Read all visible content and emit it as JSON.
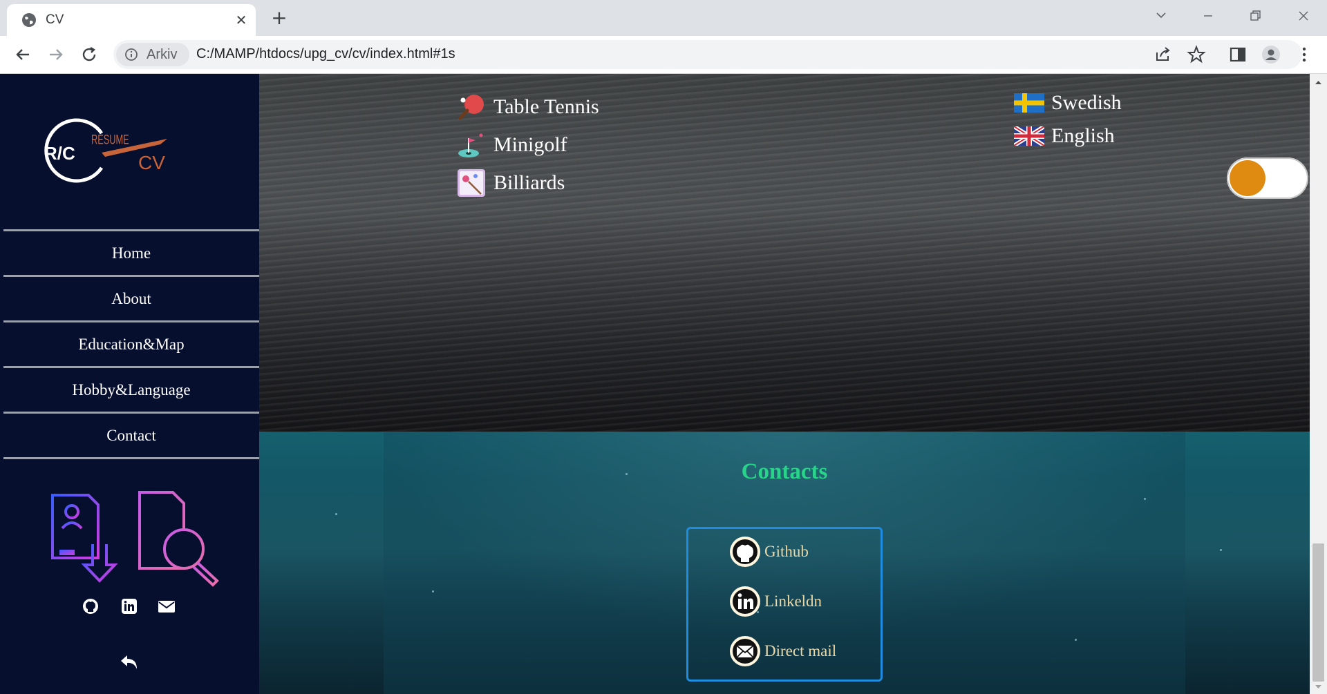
{
  "browser": {
    "tab_title": "CV",
    "chip_label": "Arkiv",
    "url": "C:/MAMP/htdocs/upg_cv/cv/index.html#1s"
  },
  "sidebar": {
    "nav_items": [
      {
        "label": "Home"
      },
      {
        "label": "About"
      },
      {
        "label": "Education&Map"
      },
      {
        "label": "Hobby&Language"
      },
      {
        "label": "Contact"
      }
    ],
    "logo_text": "R/C RESUME CV"
  },
  "hobbies": [
    {
      "label": "Table Tennis",
      "icon": "table-tennis-icon"
    },
    {
      "label": "Minigolf",
      "icon": "minigolf-icon"
    },
    {
      "label": "Billiards",
      "icon": "billiards-icon"
    }
  ],
  "languages": [
    {
      "label": "Swedish",
      "icon": "sweden-flag-icon"
    },
    {
      "label": "English",
      "icon": "uk-flag-icon"
    }
  ],
  "theme_toggle": {
    "state": "off"
  },
  "contacts": {
    "title": "Contacts",
    "items": [
      {
        "label": "Github",
        "icon": "github-icon"
      },
      {
        "label": "Linkeldn",
        "icon": "linkedin-icon"
      },
      {
        "label": "Direct mail",
        "icon": "mail-icon"
      }
    ]
  },
  "colors": {
    "sidebar_bg": "#070f2e",
    "accent_orange": "#df8a10",
    "contacts_title": "#28d48a",
    "contact_label": "#ead9a8",
    "contact_border": "#1f8ce0"
  }
}
